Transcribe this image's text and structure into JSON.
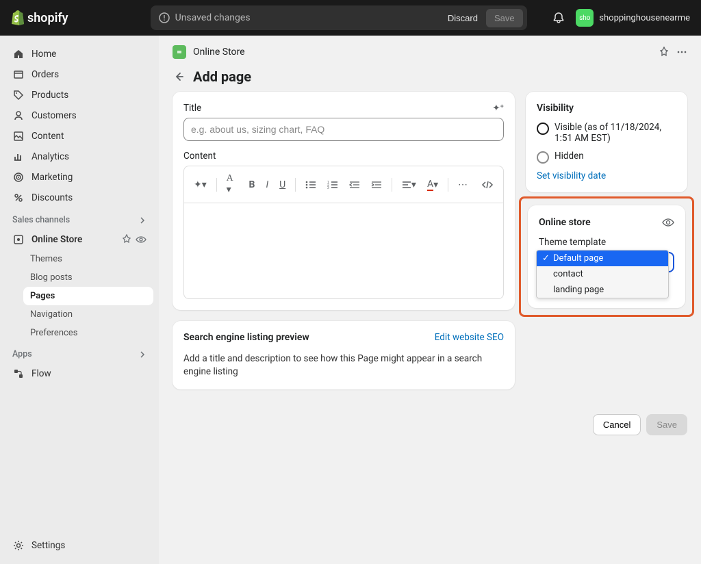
{
  "topbar": {
    "brand": "shopify",
    "unsaved": "Unsaved changes",
    "discard": "Discard",
    "save": "Save",
    "user_badge": "sho",
    "username": "shoppinghousenearme"
  },
  "sidebar": {
    "items": [
      {
        "label": "Home"
      },
      {
        "label": "Orders"
      },
      {
        "label": "Products"
      },
      {
        "label": "Customers"
      },
      {
        "label": "Content"
      },
      {
        "label": "Analytics"
      },
      {
        "label": "Marketing"
      },
      {
        "label": "Discounts"
      }
    ],
    "section_channels": "Sales channels",
    "online_store": "Online Store",
    "sub": [
      {
        "label": "Themes"
      },
      {
        "label": "Blog posts"
      },
      {
        "label": "Pages"
      },
      {
        "label": "Navigation"
      },
      {
        "label": "Preferences"
      }
    ],
    "section_apps": "Apps",
    "flow": "Flow",
    "settings": "Settings"
  },
  "header": {
    "crumb": "Online Store",
    "title": "Add page"
  },
  "main": {
    "title_label": "Title",
    "title_placeholder": "e.g. about us, sizing chart, FAQ",
    "content_label": "Content"
  },
  "visibility": {
    "heading": "Visibility",
    "visible": "Visible (as of 11/18/2024, 1:51 AM EST)",
    "hidden": "Hidden",
    "link": "Set visibility date"
  },
  "template": {
    "heading": "Online store",
    "label": "Theme template",
    "options": [
      "Default page",
      "contact",
      "landing page"
    ]
  },
  "seo": {
    "heading": "Search engine listing preview",
    "edit": "Edit website SEO",
    "desc": "Add a title and description to see how this Page might appear in a search engine listing"
  },
  "footer": {
    "cancel": "Cancel",
    "save": "Save"
  }
}
